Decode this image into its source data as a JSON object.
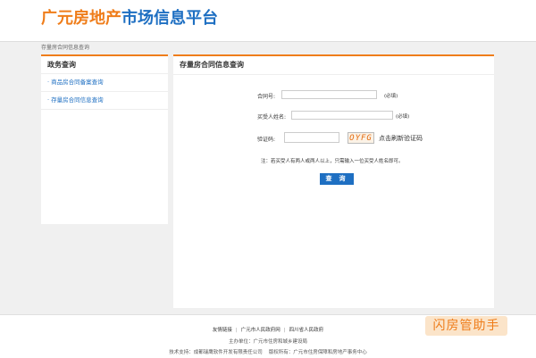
{
  "header": {
    "logo_part1": "广元房地产",
    "logo_part2": "市场信息平台"
  },
  "breadcrumb": "存量房合同信息查询",
  "sidebar": {
    "title": "政务查询",
    "items": [
      {
        "label": "· 商品房合同备案查询"
      },
      {
        "label": "· 存量房合同信息查询"
      }
    ]
  },
  "main": {
    "title": "存量房合同信息查询",
    "form": {
      "contract_label": "合同号:",
      "contract_value": "",
      "contract_required": "(必填)",
      "buyer_label": "买受人姓名:",
      "buyer_value": "",
      "buyer_required": "(必填)",
      "captcha_label": "验证码:",
      "captcha_value": "",
      "captcha_text": "OYFG",
      "refresh_label": "点击刷新验证码",
      "note": "注：若买受人有两人或两人以上，只需输入一位买受人姓名即可。",
      "submit_label": "查 询"
    }
  },
  "footer": {
    "links_label": "友情链接",
    "links": [
      "广元市人民政府网",
      "四川省人民政府"
    ],
    "organizer": "主办单位：广元市住房和城乡建设局",
    "support": "技术支持：成都瑞鹰软件开发有限责任公司",
    "copyright": "版权所有：广元市住房保障和房地产事务中心"
  },
  "watermark": "闪房管助手",
  "colors": {
    "accent": "#ef7d1a",
    "brand_blue": "#1e6fc2"
  }
}
